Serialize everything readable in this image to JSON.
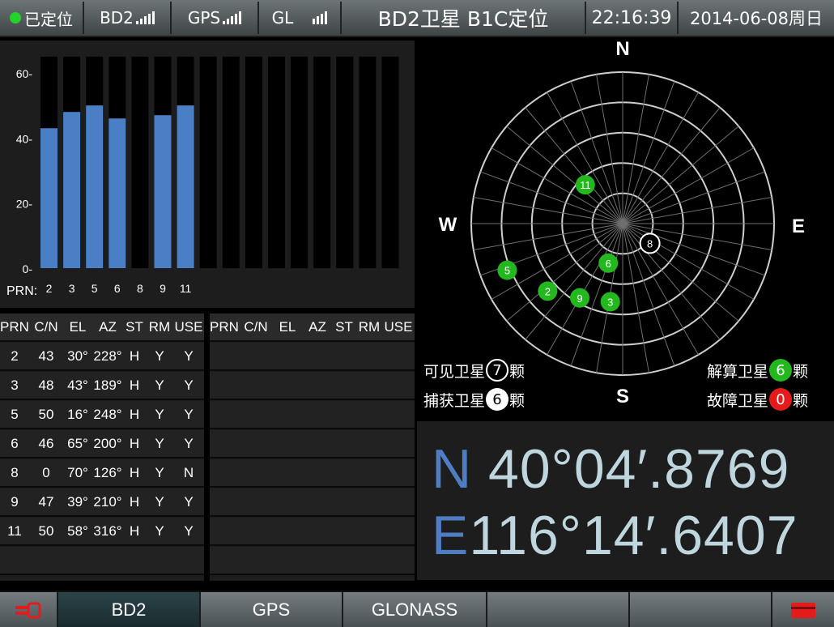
{
  "status_bar": {
    "fix_label": "已定位",
    "bd2_label": "BD2",
    "gps_label": "GPS",
    "gl_label": "GL",
    "mode_label": "BD2卫星  B1C定位",
    "time": "22:16:39",
    "date": "2014-06-08周日",
    "fix_color": "#22d32b"
  },
  "chart_data": {
    "type": "bar",
    "categories": [
      "2",
      "3",
      "5",
      "6",
      "8",
      "9",
      "11",
      "",
      "",
      "",
      "",
      "",
      "",
      "",
      "",
      ""
    ],
    "values": [
      43,
      48,
      50,
      46,
      0,
      47,
      50,
      null,
      null,
      null,
      null,
      null,
      null,
      null,
      null,
      null
    ],
    "ylim": [
      0,
      65
    ],
    "yticks": [
      0,
      20,
      40,
      60
    ],
    "x_label": "PRN:",
    "bar_color": "#4a7fc6",
    "grid": false
  },
  "satellite_table": {
    "headers": [
      "PRN",
      "C/N",
      "EL",
      "AZ",
      "ST",
      "RM",
      "USE"
    ],
    "rows": [
      [
        "2",
        "43",
        "30°",
        "228°",
        "H",
        "Y",
        "Y"
      ],
      [
        "3",
        "48",
        "43°",
        "189°",
        "H",
        "Y",
        "Y"
      ],
      [
        "5",
        "50",
        "16°",
        "248°",
        "H",
        "Y",
        "Y"
      ],
      [
        "6",
        "46",
        "65°",
        "200°",
        "H",
        "Y",
        "Y"
      ],
      [
        "8",
        "0",
        "70°",
        "126°",
        "H",
        "Y",
        "N"
      ],
      [
        "9",
        "47",
        "39°",
        "210°",
        "H",
        "Y",
        "Y"
      ],
      [
        "11",
        "50",
        "58°",
        "316°",
        "H",
        "Y",
        "Y"
      ]
    ]
  },
  "skyplot": {
    "north": "N",
    "south": "S",
    "east": "E",
    "west": "W",
    "satellites": [
      {
        "prn": "2",
        "el": 30,
        "az": 228,
        "used": true
      },
      {
        "prn": "3",
        "el": 43,
        "az": 189,
        "used": true
      },
      {
        "prn": "5",
        "el": 16,
        "az": 248,
        "used": true
      },
      {
        "prn": "6",
        "el": 65,
        "az": 200,
        "used": true
      },
      {
        "prn": "8",
        "el": 70,
        "az": 126,
        "used": false
      },
      {
        "prn": "9",
        "el": 39,
        "az": 210,
        "used": true
      },
      {
        "prn": "11",
        "el": 58,
        "az": 316,
        "used": true
      }
    ],
    "used_color": "#22b81e"
  },
  "stats": {
    "visible_label": "可见卫星",
    "visible_count": "7",
    "tracked_label": "捕获卫星",
    "tracked_count": "6",
    "solved_label": "解算卫星",
    "solved_count": "6",
    "fault_label": "故障卫星",
    "fault_count": "0",
    "unit": "颗",
    "solved_color": "#22b81e",
    "fault_color": "#e51b1b"
  },
  "position": {
    "lat_hemi": "N",
    "lat_value": "40°04′.8769",
    "lon_hemi": "E",
    "lon_value": "116°14′.6407"
  },
  "bottom_menu": {
    "bd2_label": "BD2",
    "gps_label": "GPS",
    "glonass_label": "GLONASS",
    "left_icon": "key-icon",
    "right_icon": "card-icon"
  }
}
